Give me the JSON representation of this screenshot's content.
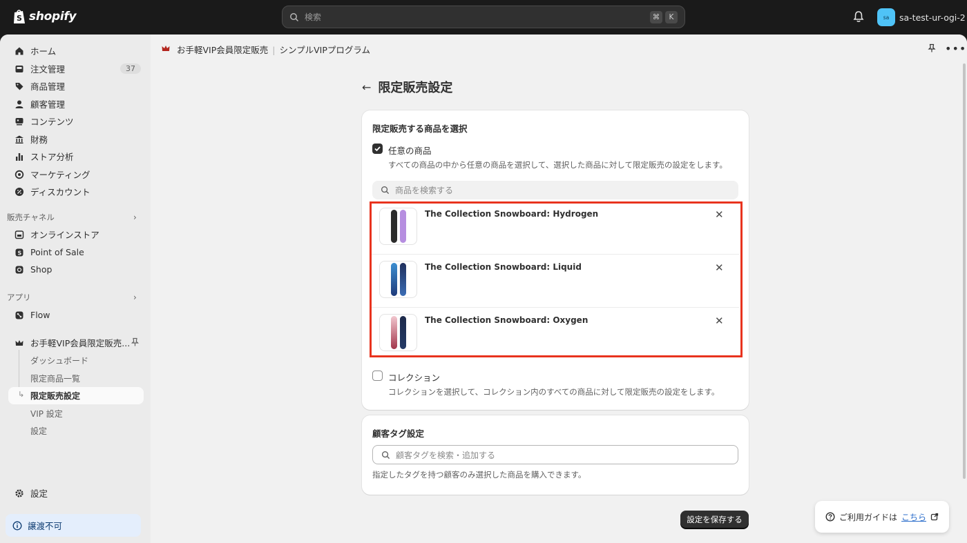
{
  "topbar": {
    "logo_text": "shopify",
    "search_placeholder": "検索",
    "shortcut_keys": [
      "⌘",
      "K"
    ],
    "store_avatar": "sa",
    "store_name": "sa-test-ur-ogi-2"
  },
  "sidebar": {
    "main_items": [
      {
        "label": "ホーム",
        "icon": "home-icon"
      },
      {
        "label": "注文管理",
        "icon": "inbox-icon",
        "badge": "37"
      },
      {
        "label": "商品管理",
        "icon": "tag-icon"
      },
      {
        "label": "顧客管理",
        "icon": "person-icon"
      },
      {
        "label": "コンテンツ",
        "icon": "content-icon"
      },
      {
        "label": "財務",
        "icon": "bank-icon"
      },
      {
        "label": "ストア分析",
        "icon": "chart-icon"
      },
      {
        "label": "マーケティング",
        "icon": "target-icon"
      },
      {
        "label": "ディスカウント",
        "icon": "discount-icon"
      }
    ],
    "sales_channels_label": "販売チャネル",
    "sales_channels": [
      {
        "label": "オンラインストア",
        "icon": "store-icon"
      },
      {
        "label": "Point of Sale",
        "icon": "pos-icon"
      },
      {
        "label": "Shop",
        "icon": "shop-icon"
      }
    ],
    "apps_label": "アプリ",
    "apps": [
      {
        "label": "Flow",
        "icon": "flow-icon"
      }
    ],
    "app_name": "お手軽VIP会員限定販売...",
    "app_sub_items": [
      "ダッシュボード",
      "限定商品一覧",
      "限定販売設定",
      "VIP 設定",
      "設定"
    ],
    "settings_label": "設定",
    "notice_label": "譲渡不可"
  },
  "app_header": {
    "app_name": "お手軽VIP会員限定販売",
    "plan_name": "シンプルVIPプログラム"
  },
  "page": {
    "title": "限定販売設定",
    "product_card": {
      "title": "限定販売する商品を選択",
      "option_any": {
        "label": "任意の商品",
        "description": "すべての商品の中から任意の商品を選択して、選択した商品に対して限定販売の設定をします。",
        "checked": true
      },
      "search_placeholder": "商品を検索する",
      "products": [
        {
          "name": "The Collection Snowboard: Hydrogen"
        },
        {
          "name": "The Collection Snowboard: Liquid"
        },
        {
          "name": "The Collection Snowboard: Oxygen"
        }
      ],
      "option_collection": {
        "label": "コレクション",
        "description": "コレクションを選択して、コレクション内のすべての商品に対して限定販売の設定をします。",
        "checked": false
      }
    },
    "tag_card": {
      "title": "顧客タグ設定",
      "search_placeholder": "顧客タグを検索・追加する",
      "help": "指定したタグを持つ顧客のみ選択した商品を購入できます。"
    },
    "save_label": "設定を保存する"
  },
  "guide": {
    "text": "ご利用ガイドは",
    "link": "こちら"
  },
  "colors": {
    "highlight": "#e8331e",
    "primary_button": "#303030",
    "link": "#2c6ecb"
  }
}
